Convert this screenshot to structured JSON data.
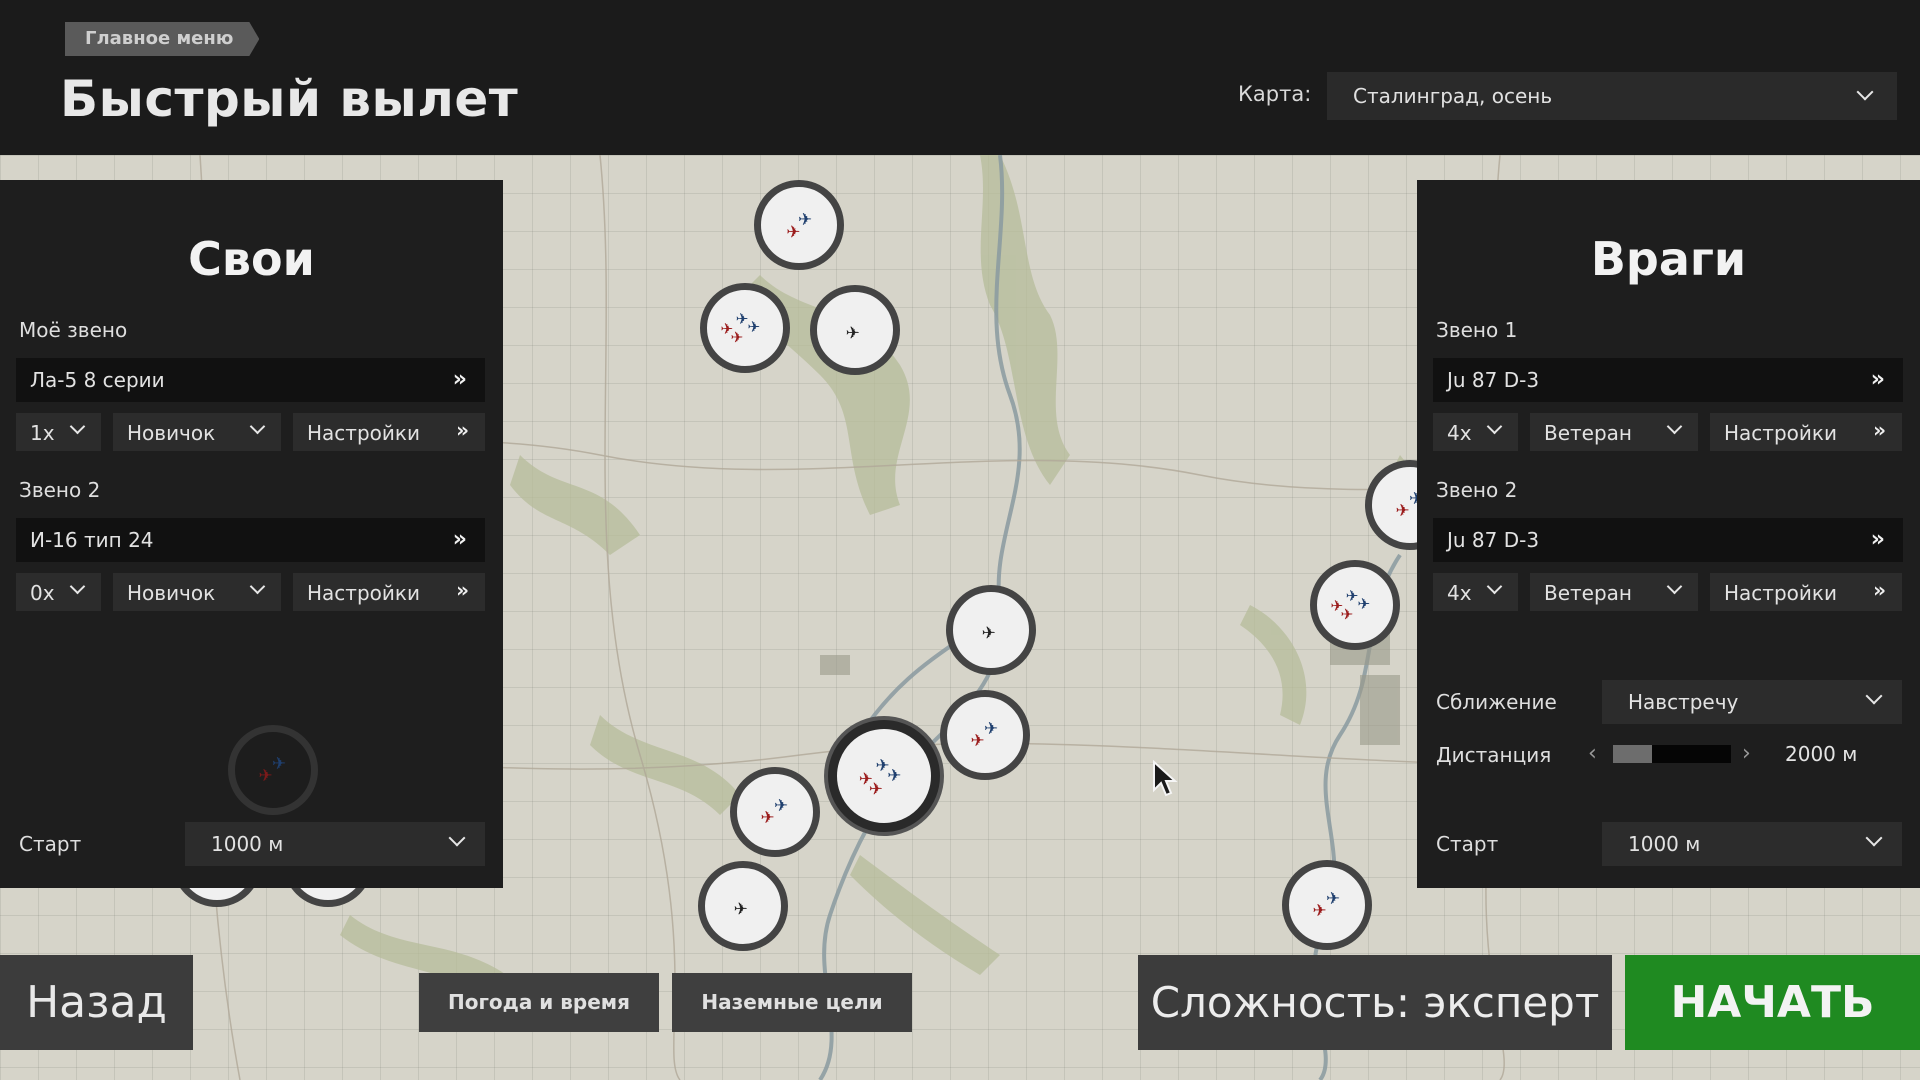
{
  "header": {
    "breadcrumb": "Главное меню",
    "title": "Быстрый вылет",
    "map_label": "Карта:",
    "map_value": "Сталинград, осень"
  },
  "left_panel": {
    "title": "Свои",
    "flight1": {
      "label": "Моё звено",
      "aircraft": "Ла-5 8 серии",
      "count": "1x",
      "skill": "Новичок",
      "settings": "Настройки"
    },
    "flight2": {
      "label": "Звено 2",
      "aircraft": "И-16 тип 24",
      "count": "0x",
      "skill": "Новичок",
      "settings": "Настройки"
    },
    "start_label": "Старт",
    "start_value": "1000 м"
  },
  "right_panel": {
    "title": "Враги",
    "flight1": {
      "label": "Звено 1",
      "aircraft": "Ju 87 D-3",
      "count": "4x",
      "skill": "Ветеран",
      "settings": "Настройки"
    },
    "flight2": {
      "label": "Звено 2",
      "aircraft": "Ju 87 D-3",
      "count": "4x",
      "skill": "Ветеран",
      "settings": "Настройки"
    },
    "approach_label": "Сближение",
    "approach_value": "Навстречу",
    "distance_label": "Дистанция",
    "distance_value": "2000 м",
    "distance_fraction": 0.33,
    "start_label": "Старт",
    "start_value": "1000 м"
  },
  "bottom": {
    "back": "Назад",
    "weather": "Погода и время",
    "ground_targets": "Наземные цели",
    "difficulty": "Сложность: эксперт",
    "start": "НАЧАТЬ"
  },
  "icons": {
    "double_chevron": "»",
    "slider_left": "‹",
    "slider_right": "›"
  },
  "colors": {
    "start_button": "#1f8a21",
    "friendly": "#1f3f6e",
    "enemy": "#9b1c1c"
  }
}
